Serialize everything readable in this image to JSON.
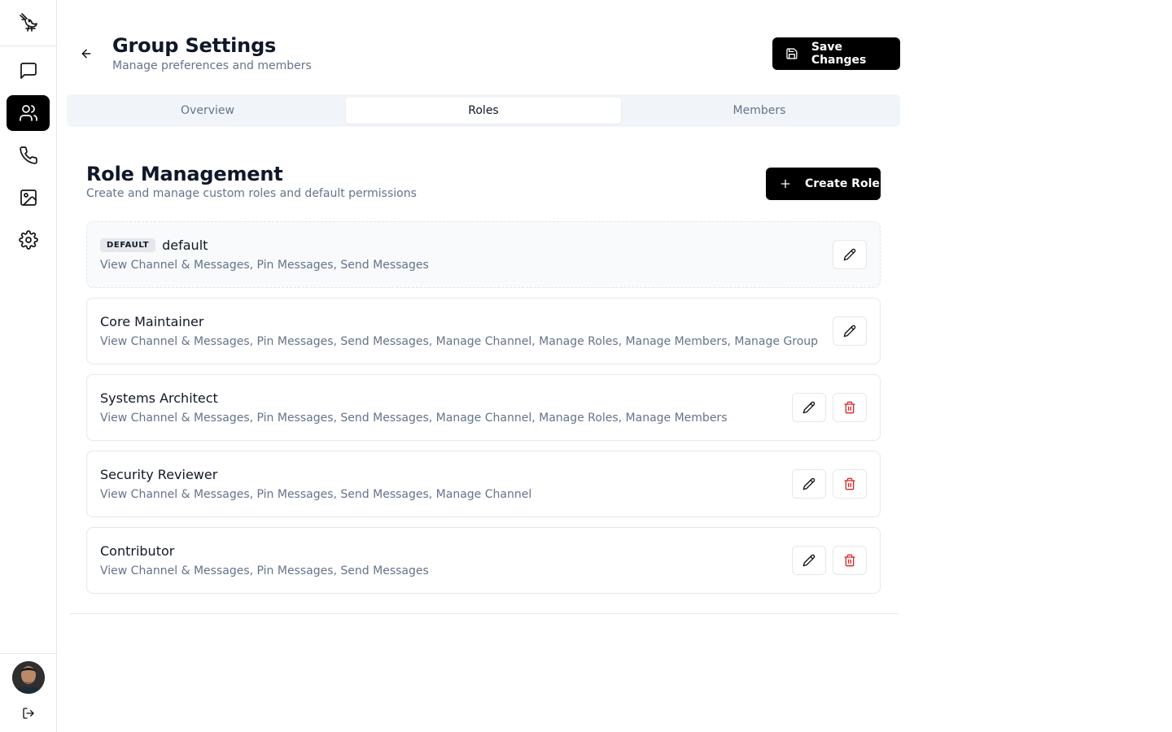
{
  "header": {
    "title": "Group Settings",
    "subtitle": "Manage preferences and members",
    "save_label": "Save Changes"
  },
  "tabs": [
    {
      "label": "Overview",
      "active": false
    },
    {
      "label": "Roles",
      "active": true
    },
    {
      "label": "Members",
      "active": false
    }
  ],
  "sidebar": {
    "items": [
      {
        "icon": "message-icon",
        "active": false
      },
      {
        "icon": "users-icon",
        "active": true
      },
      {
        "icon": "phone-icon",
        "active": false
      },
      {
        "icon": "image-icon",
        "active": false
      },
      {
        "icon": "settings-icon",
        "active": false
      }
    ]
  },
  "roles_section": {
    "title": "Role Management",
    "subtitle": "Create and manage custom roles and default permissions",
    "create_label": "Create Role"
  },
  "roles": [
    {
      "name": "default",
      "badge": "DEFAULT",
      "permissions": "View Channel & Messages, Pin Messages, Send Messages",
      "deletable": false
    },
    {
      "name": "Core Maintainer",
      "badge": "",
      "permissions": "View Channel & Messages, Pin Messages, Send Messages, Manage Channel, Manage Roles, Manage Members, Manage Group",
      "deletable": false
    },
    {
      "name": "Systems Architect",
      "badge": "",
      "permissions": "View Channel & Messages, Pin Messages, Send Messages, Manage Channel, Manage Roles, Manage Members",
      "deletable": true
    },
    {
      "name": "Security Reviewer",
      "badge": "",
      "permissions": "View Channel & Messages, Pin Messages, Send Messages, Manage Channel",
      "deletable": true
    },
    {
      "name": "Contributor",
      "badge": "",
      "permissions": "View Channel & Messages, Pin Messages, Send Messages",
      "deletable": true
    }
  ],
  "colors": {
    "accent": "#000000",
    "delete": "#dc2626",
    "muted_text": "#64748b",
    "border": "#e5e7eb"
  }
}
